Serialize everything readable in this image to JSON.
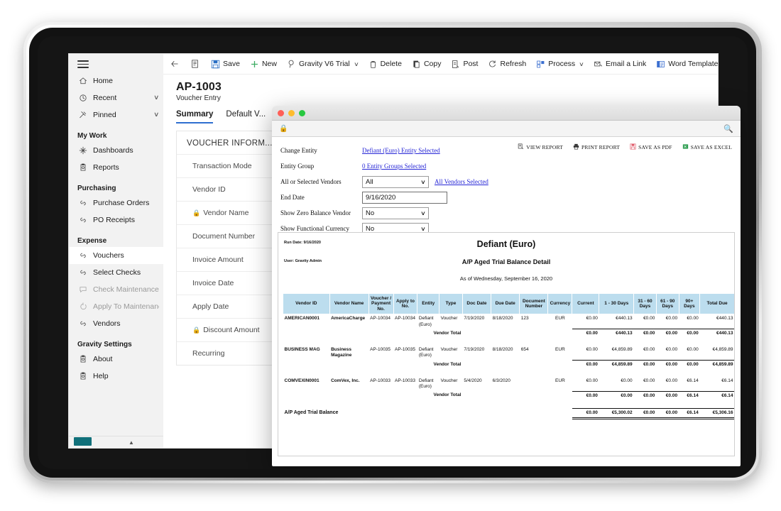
{
  "app": {
    "sidebar": {
      "menu_icon": "hamburger-icon",
      "top_items": [
        {
          "label": "Home",
          "icon": "home-icon",
          "chevron": false
        },
        {
          "label": "Recent",
          "icon": "clock-icon",
          "chevron": true
        },
        {
          "label": "Pinned",
          "icon": "pin-icon",
          "chevron": true
        }
      ],
      "groups": [
        {
          "title": "My Work",
          "items": [
            {
              "label": "Dashboards",
              "icon": "dashboard-icon",
              "selected": false,
              "dim": false
            },
            {
              "label": "Reports",
              "icon": "report-icon",
              "selected": false,
              "dim": false
            }
          ]
        },
        {
          "title": "Purchasing",
          "items": [
            {
              "label": "Purchase Orders",
              "icon": "link-icon",
              "selected": false,
              "dim": false
            },
            {
              "label": "PO Receipts",
              "icon": "link-icon",
              "selected": false,
              "dim": false
            }
          ]
        },
        {
          "title": "Expense",
          "items": [
            {
              "label": "Vouchers",
              "icon": "link-icon",
              "selected": true,
              "dim": false
            },
            {
              "label": "Select Checks",
              "icon": "link-icon",
              "selected": false,
              "dim": false
            },
            {
              "label": "Check Maintenance",
              "icon": "check-icon",
              "selected": false,
              "dim": true
            },
            {
              "label": "Apply To Maintenance",
              "icon": "apply-icon",
              "selected": false,
              "dim": true
            },
            {
              "label": "Vendors",
              "icon": "link-icon",
              "selected": false,
              "dim": false
            }
          ]
        },
        {
          "title": "Gravity Settings",
          "items": [
            {
              "label": "About",
              "icon": "info-icon",
              "selected": false,
              "dim": false
            },
            {
              "label": "Help",
              "icon": "help-icon",
              "selected": false,
              "dim": false
            }
          ]
        }
      ]
    },
    "toolbar": {
      "back": "back-arrow",
      "list_icon": "list-icon",
      "items": [
        {
          "label": "Save",
          "icon": "save-icon",
          "chevron": false
        },
        {
          "label": "New",
          "icon": "plus-icon",
          "chevron": false
        },
        {
          "label": "Gravity V6 Trial",
          "icon": "balloon-icon",
          "chevron": true
        },
        {
          "label": "Delete",
          "icon": "trash-icon",
          "chevron": false
        },
        {
          "label": "Copy",
          "icon": "copy-icon",
          "chevron": false
        },
        {
          "label": "Post",
          "icon": "post-icon",
          "chevron": false
        },
        {
          "label": "Refresh",
          "icon": "refresh-icon",
          "chevron": false
        },
        {
          "label": "Process",
          "icon": "process-icon",
          "chevron": true
        },
        {
          "label": "Email a Link",
          "icon": "email-icon",
          "chevron": false
        },
        {
          "label": "Word Templates",
          "icon": "word-icon",
          "chevron": true
        }
      ],
      "overflow": "kebab-menu-icon"
    },
    "document": {
      "id": "AP-1003",
      "subtitle": "Voucher Entry",
      "tabs": [
        {
          "label": "Summary",
          "active": true
        },
        {
          "label": "Default V...",
          "active": false
        }
      ],
      "card_title": "VOUCHER INFORM...",
      "fields": [
        {
          "label": "Transaction Mode",
          "locked": false
        },
        {
          "label": "Vendor ID",
          "locked": false
        },
        {
          "label": "Vendor Name",
          "locked": true
        },
        {
          "label": "Document Number",
          "locked": false
        },
        {
          "label": "Invoice Amount",
          "locked": false
        },
        {
          "label": "Invoice Date",
          "locked": false
        },
        {
          "label": "Apply Date",
          "locked": false
        },
        {
          "label": "Discount Amount",
          "locked": true
        },
        {
          "label": "Recurring",
          "locked": false
        }
      ]
    }
  },
  "dialog": {
    "window_controls": {
      "close": "close-dot",
      "minimize": "minimize-dot",
      "maximize": "maximize-dot"
    },
    "urlbar": {
      "lock": "lock-icon",
      "search": "search-icon"
    },
    "parameters": [
      {
        "label": "Change Entity",
        "type": "link",
        "value": "Defiant (Euro) Entity Selected"
      },
      {
        "label": "Entity Group",
        "type": "link",
        "value": "0 Entity Groups Selected"
      },
      {
        "label": "All or Selected Vendors",
        "type": "select",
        "value": "All",
        "after_link": "All Vendors Selected"
      },
      {
        "label": "End Date",
        "type": "text",
        "value": "9/16/2020"
      },
      {
        "label": "Show Zero Balance Vendor",
        "type": "select",
        "value": "No"
      },
      {
        "label": "Show Functional Currency",
        "type": "select",
        "value": "No"
      }
    ],
    "report_actions": [
      {
        "label": "VIEW REPORT",
        "icon": "view-report-icon"
      },
      {
        "label": "PRINT REPORT",
        "icon": "printer-icon"
      },
      {
        "label": "SAVE AS PDF",
        "icon": "save-pdf-icon"
      },
      {
        "label": "SAVE AS EXCEL",
        "icon": "save-excel-icon"
      }
    ]
  },
  "report": {
    "run_date": "Run Date: 9/16/2020",
    "user": "User: Gravity Admin",
    "entity": "Defiant (Euro)",
    "title": "A/P Aged Trial Balance Detail",
    "as_of": "As of Wednesday, September 16, 2020",
    "columns": [
      "Vendor ID",
      "Vendor Name",
      "Voucher / Payment No.",
      "Apply to No.",
      "Entity",
      "Type",
      "Doc Date",
      "Due Date",
      "Document Number",
      "Currency",
      "Current",
      "1 - 30 Days",
      "31 - 60 Days",
      "61 - 90 Days",
      "90+ Days",
      "Total Due"
    ],
    "vendor_total_label": "Vendor Total",
    "grand_total_label": "A/P Aged Trial Balance",
    "rows": [
      {
        "vendor_id": "AMERICAN0001",
        "vendor_name": "AmericaCharge",
        "voucher_no": "AP-10034",
        "apply_to_no": "AP-10034",
        "entity": "Defiant (Euro)",
        "type": "Voucher",
        "doc_date": "7/19/2020",
        "due_date": "8/18/2020",
        "document_number": "123",
        "currency": "EUR",
        "current": "€0.00",
        "d1_30": "€440.13",
        "d31_60": "€0.00",
        "d61_90": "€0.00",
        "d90p": "€0.00",
        "total_due": "€440.13",
        "totals": {
          "current": "€0.00",
          "d1_30": "€440.13",
          "d31_60": "€0.00",
          "d61_90": "€0.00",
          "d90p": "€0.00",
          "total_due": "€440.13"
        }
      },
      {
        "vendor_id": "BUSINESS MAG",
        "vendor_name": "Business Magazine",
        "voucher_no": "AP-10035",
        "apply_to_no": "AP-10035",
        "entity": "Defiant (Euro)",
        "type": "Voucher",
        "doc_date": "7/19/2020",
        "due_date": "8/18/2020",
        "document_number": "654",
        "currency": "EUR",
        "current": "€0.00",
        "d1_30": "€4,859.89",
        "d31_60": "€0.00",
        "d61_90": "€0.00",
        "d90p": "€0.00",
        "total_due": "€4,859.89",
        "totals": {
          "current": "€0.00",
          "d1_30": "€4,859.89",
          "d31_60": "€0.00",
          "d61_90": "€0.00",
          "d90p": "€0.00",
          "total_due": "€4,859.89"
        }
      },
      {
        "vendor_id": "COMVEXIN0001",
        "vendor_name": "ComVex, Inc.",
        "voucher_no": "AP-10033",
        "apply_to_no": "AP-10033",
        "entity": "Defiant (Euro)",
        "type": "Voucher",
        "doc_date": "5/4/2020",
        "due_date": "6/3/2020",
        "document_number": "",
        "currency": "EUR",
        "current": "€0.00",
        "d1_30": "€0.00",
        "d31_60": "€0.00",
        "d61_90": "€0.00",
        "d90p": "€6.14",
        "total_due": "€6.14",
        "totals": {
          "current": "€0.00",
          "d1_30": "€0.00",
          "d31_60": "€0.00",
          "d61_90": "€0.00",
          "d90p": "€6.14",
          "total_due": "€6.14"
        }
      }
    ],
    "grand_total": {
      "current": "€0.00",
      "d1_30": "€5,300.02",
      "d31_60": "€0.00",
      "d61_90": "€0.00",
      "d90p": "€6.14",
      "total_due": "€5,306.16"
    }
  },
  "colors": {
    "accent": "#2f6fd0",
    "table_header": "#bcddee",
    "link": "#2626d6",
    "teal": "#11707a"
  }
}
